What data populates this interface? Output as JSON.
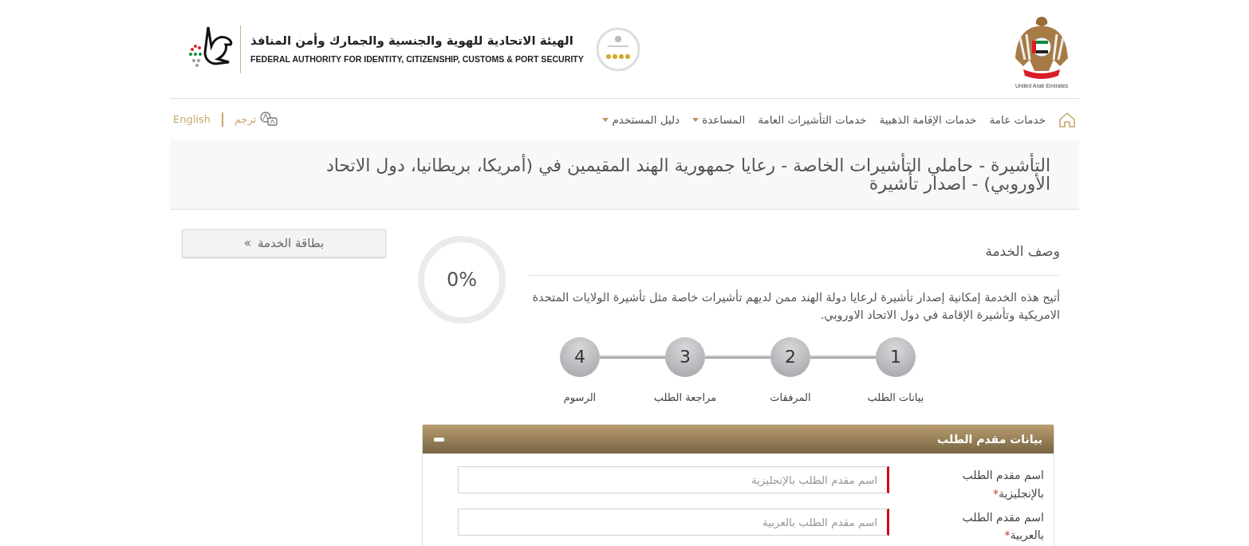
{
  "header": {
    "emblem_caption": "United Arab Emirates",
    "authority_name_ar": "الهيئة الاتحادية للهوية والجنسية والجمارك وأمن المنافذ",
    "authority_name_en": "FEDERAL AUTHORITY FOR IDENTITY, CITIZENSHIP, CUSTOMS & PORT SECURITY"
  },
  "nav": {
    "items": [
      {
        "label": "خدمات عامة",
        "has_menu": false
      },
      {
        "label": "خدمات الإقامة الذهبية",
        "has_menu": false
      },
      {
        "label": "خدمات التأشيرات العامة",
        "has_menu": false
      },
      {
        "label": "المساعدة",
        "has_menu": true
      },
      {
        "label": "دليل المستخدم",
        "has_menu": true
      }
    ],
    "translate": "ترجم",
    "language": "English"
  },
  "page_title": "التأشيرة - حاملي التأشيرات الخاصة - رعايا جمهورية الهند المقيمين في (أمريكا، بريطانيا، دول الاتحاد الأوروبي) - اصدار تأشيرة",
  "service": {
    "heading": "وصف الخدمة",
    "description": "أتيح هذه الخدمة إمكانية إصدار تأشيرة لرعايا دولة الهند ممن لديهم تأشيرات خاصة مثل تأشيرة الولايات المتحدة الامريكية وتأشيرة الإقامة في دول الاتحاد الاوروبي.",
    "progress": {
      "reading": "0%",
      "level": 0
    }
  },
  "steps": [
    {
      "number": "1",
      "label": "بيانات الطلب"
    },
    {
      "number": "2",
      "label": "المرفقات"
    },
    {
      "number": "3",
      "label": "مراجعة الطلب"
    },
    {
      "number": "4",
      "label": "الرسوم"
    }
  ],
  "sidebar": {
    "button": {
      "icon": "»",
      "label": "بطاقة الخدمة"
    }
  },
  "panel": {
    "title": "بيانات مقدم الطلب",
    "expanded": true,
    "fields": [
      {
        "label": "اسم مقدم الطلب بالإنجليزية",
        "required_mark": "*",
        "placeholder": "اسم مقدم الطلب بالإنجليزية"
      },
      {
        "label": "اسم مقدم الطلب بالعربية",
        "required_mark": "*",
        "placeholder": "اسم مقدم الطلب بالعربية"
      }
    ]
  }
}
